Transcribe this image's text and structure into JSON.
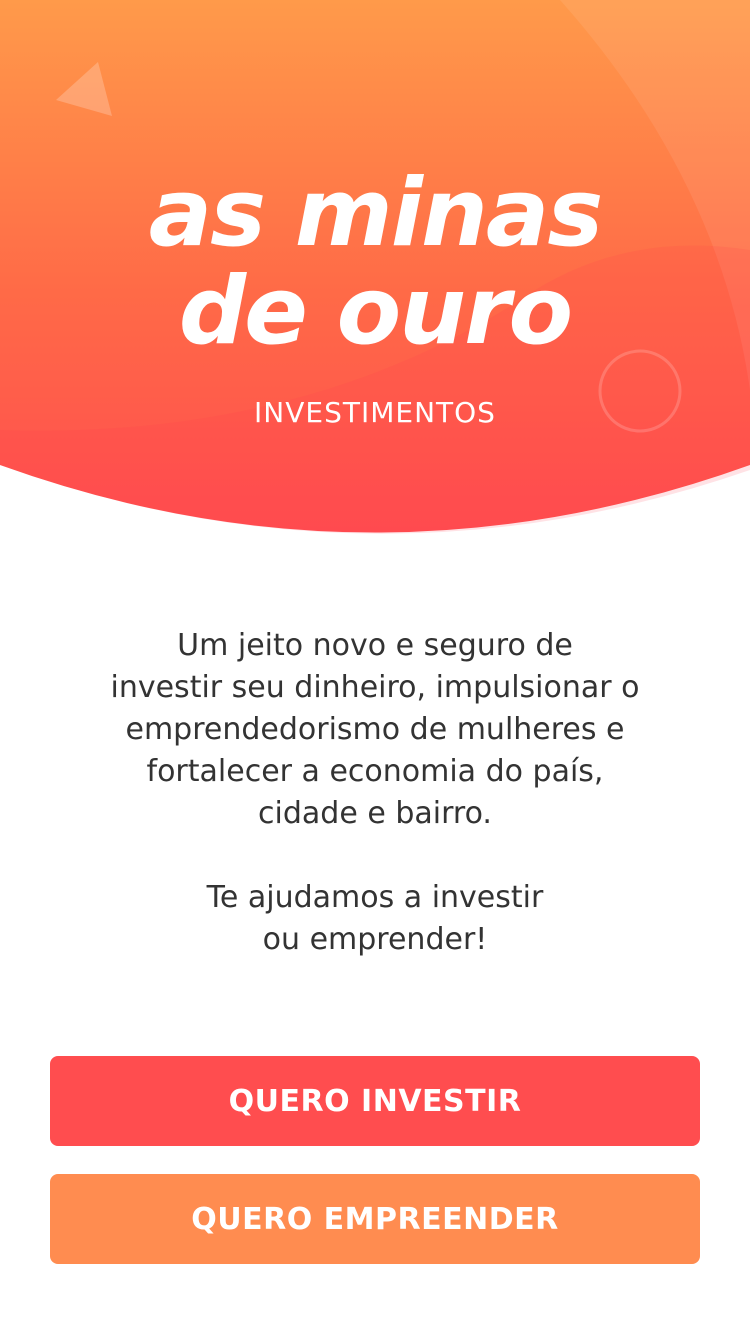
{
  "hero": {
    "logo_line1": "as minas",
    "logo_line2": "de ouro",
    "subtitle": "INVESTIMENTOS"
  },
  "intro": {
    "paragraph1_lines": [
      "Um jeito novo e seguro de",
      "investir seu dinheiro, impulsionar o",
      "emprendedorismo de mulheres e",
      "fortalecer a economia do país,",
      "cidade e bairro."
    ],
    "paragraph2_lines": [
      "Te ajudamos a investir",
      "ou emprender!"
    ]
  },
  "buttons": {
    "invest_label": "QUERO INVESTIR",
    "empreender_label": "QUERO EMPREENDER"
  },
  "colors": {
    "gradient_top": "#ff9a4a",
    "gradient_bottom": "#ff4d4f",
    "invest_button": "#ff4d4f",
    "empreender_button": "#ff8c50",
    "text": "#333333"
  }
}
